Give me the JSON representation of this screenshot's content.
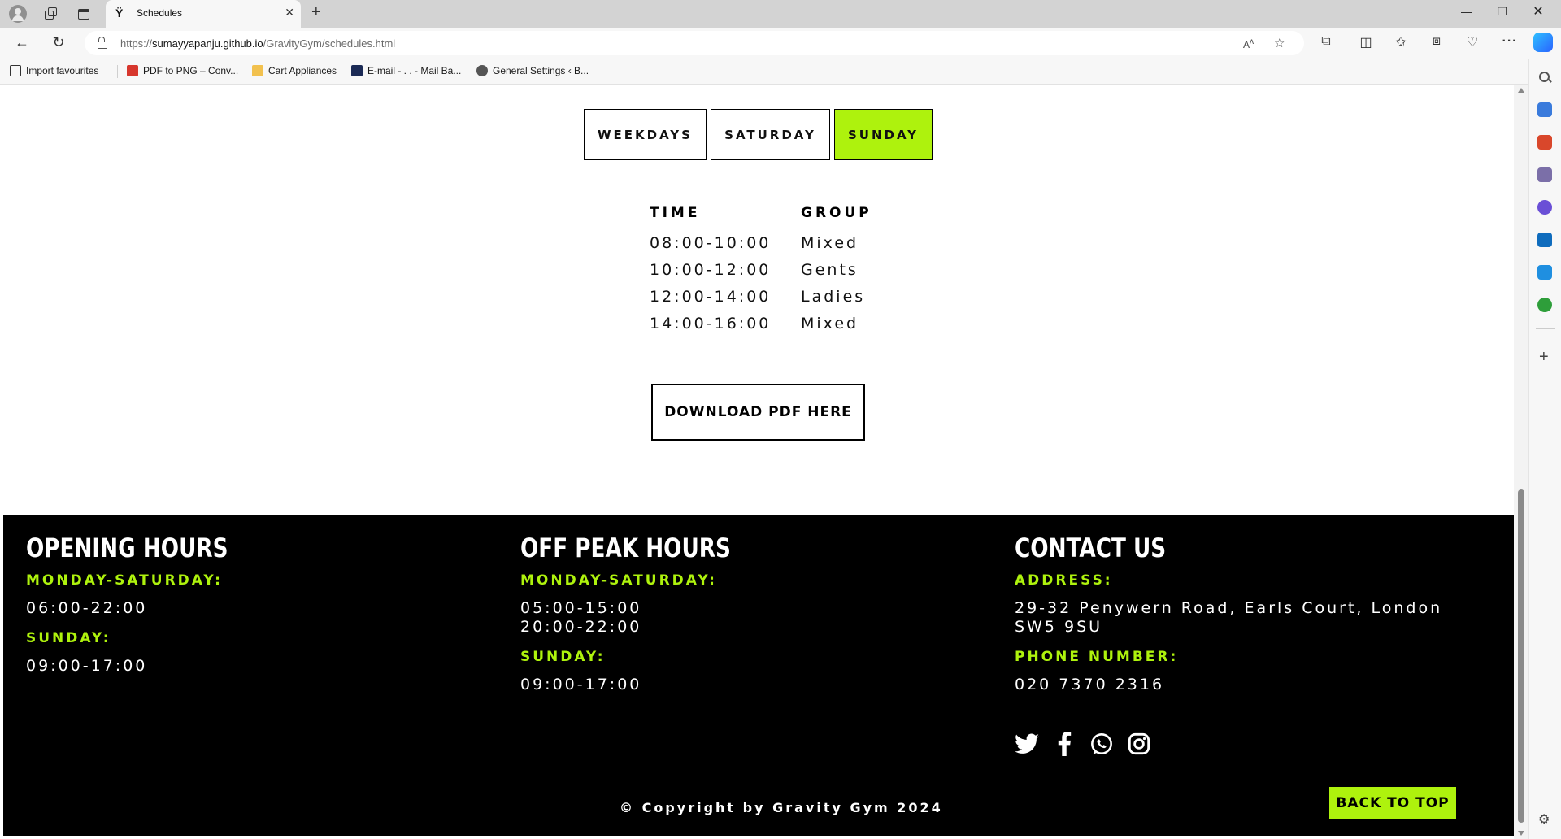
{
  "browser": {
    "tab_title": "Schedules",
    "tab_favicon": "gym-figure-icon",
    "url_prefix": "https://",
    "url_host": "sumayyapanju.github.io",
    "url_path": "/GravityGym/schedules.html",
    "favourites": [
      {
        "label": "Import favourites",
        "icon": "import-icon"
      },
      {
        "label": "PDF to PNG – Conv...",
        "icon": "pdf-icon"
      },
      {
        "label": "Cart Appliances",
        "icon": "folder-icon"
      },
      {
        "label": "E-mail - . . - Mail Ba...",
        "icon": "mail-icon"
      },
      {
        "label": "General Settings ‹ B...",
        "icon": "wordpress-icon"
      }
    ]
  },
  "schedule": {
    "day_tabs": [
      {
        "label": "WEEKDAYS",
        "active": false
      },
      {
        "label": "SATURDAY",
        "active": false
      },
      {
        "label": "SUNDAY",
        "active": true
      }
    ],
    "headers": {
      "time": "TIME",
      "group": "GROUP"
    },
    "rows": [
      {
        "time": "08:00-10:00",
        "group": "Mixed"
      },
      {
        "time": "10:00-12:00",
        "group": "Gents"
      },
      {
        "time": "12:00-14:00",
        "group": "Ladies"
      },
      {
        "time": "14:00-16:00",
        "group": "Mixed"
      }
    ],
    "download_label": "DOWNLOAD PDF HERE"
  },
  "footer": {
    "opening": {
      "title": "OPENING HOURS",
      "sub1": "MONDAY-SATURDAY:",
      "val1": "06:00-22:00",
      "sub2": "SUNDAY:",
      "val2": "09:00-17:00"
    },
    "offpeak": {
      "title": "OFF PEAK HOURS",
      "sub1": "MONDAY-SATURDAY:",
      "val1a": "05:00-15:00",
      "val1b": "20:00-22:00",
      "sub2": "SUNDAY:",
      "val2": "09:00-17:00"
    },
    "contact": {
      "title": "CONTACT US",
      "sub1": "ADDRESS:",
      "val1": "29-32 Penywern Road, Earls Court, London SW5 9SU",
      "sub2": "PHONE NUMBER:",
      "val2": "020 7370 2316"
    },
    "social": [
      "twitter-icon",
      "facebook-icon",
      "whatsapp-icon",
      "instagram-icon"
    ],
    "copyright": "© Copyright by Gravity Gym 2024",
    "back_to_top": "BACK TO TOP"
  },
  "colors": {
    "accent": "#aef20d",
    "footer_bg": "#000000",
    "page_bg": "#ffffff"
  }
}
